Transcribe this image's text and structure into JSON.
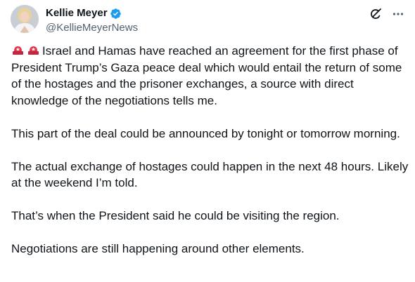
{
  "author": {
    "name": "Kellie Meyer",
    "handle": "@KellieMeyerNews",
    "verified": true,
    "avatar_icon": "profile-photo"
  },
  "actions": {
    "grok_icon": "grok-icon",
    "more_icon": "more-icon"
  },
  "colors": {
    "text": "#0f1419",
    "secondary": "#536471",
    "verified_blue": "#1d9bf0",
    "siren_red": "#e3324a"
  },
  "tweet": {
    "lead_emoji": "police-light-emoji",
    "paragraphs": [
      "Israel and Hamas have reached an agreement for the first phase of President Trump’s Gaza peace deal which would entail the return of some of the hostages and the prisoner exchanges, a source with direct knowledge of the negotiations tells me.",
      "This part of the deal could be announced by tonight or tomorrow morning.",
      "The actual exchange of hostages could happen in the next 48 hours. Likely at the weekend I’m told.",
      "That’s when the President said he could be visiting the region.",
      "Negotiations are still happening around other elements."
    ]
  }
}
